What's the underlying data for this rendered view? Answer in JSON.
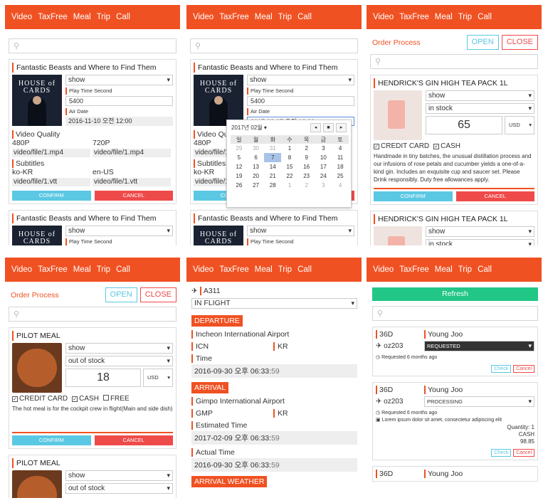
{
  "nav": [
    "Video",
    "TaxFree",
    "Meal",
    "Trip",
    "Call"
  ],
  "video": {
    "title": "Fantastic Beasts and Where to Find Them",
    "poster_text": "HOUSE of CARDS",
    "display": "show",
    "play_time_label": "Play Time Second",
    "play_time": "5400",
    "air_date_label": "Air Date",
    "air_date": "2016-11-10 오전 12:00",
    "air_date2": "2017-02-07 오전 12:00",
    "quality_label": "Video Quality",
    "q1": "480P",
    "q2": "720P",
    "q1_path": "video/file/1.mp4",
    "q2_path": "video/file/1.mp4",
    "subs_label": "Subtitles",
    "s1": "ko-KR",
    "s2": "en-US",
    "s1_path": "video/file/1.vtt",
    "s2_path": "video/file/1.vtt",
    "confirm": "CONFIRM",
    "cancel": "CANCEL"
  },
  "calendar": {
    "month": "2017년 02월",
    "weekdays": [
      "일",
      "월",
      "화",
      "수",
      "목",
      "금",
      "토"
    ],
    "weeks": [
      [
        "29",
        "30",
        "31",
        "1",
        "2",
        "3",
        "4"
      ],
      [
        "5",
        "6",
        "7",
        "8",
        "9",
        "10",
        "11"
      ],
      [
        "12",
        "13",
        "14",
        "15",
        "16",
        "17",
        "18"
      ],
      [
        "19",
        "20",
        "21",
        "22",
        "23",
        "24",
        "25"
      ],
      [
        "26",
        "27",
        "28",
        "1",
        "2",
        "3",
        "4"
      ]
    ]
  },
  "order": {
    "title": "Order Process",
    "open": "OPEN",
    "close": "CLOSE"
  },
  "gin": {
    "name": "HENDRICK'S GIN HIGH TEA PACK 1L",
    "display": "show",
    "stock": "in stock",
    "price": "65",
    "currency": "USD",
    "credit": "CREDIT CARD",
    "cash": "CASH",
    "desc": "Handmade in tiny batches, the unusual distillation process and our infusions of rose petals and cucumber yields a one-of-a-kind gin. Includes an exquisite cup and saucer set. Please Drink responsibly. Duty free allowances apply.",
    "confirm": "CONFIRM",
    "cancel": "CANCEL"
  },
  "meal": {
    "name": "PILOT MEAL",
    "display": "show",
    "stock": "out of stock",
    "price": "18",
    "currency": "USD",
    "credit": "CREDIT CARD",
    "cash": "CASH",
    "free": "FREE",
    "desc": "The hot meal is for the cockpit crew in flight(Main and side dish)",
    "confirm": "CONFIRM",
    "cancel": "CANCEL",
    "stock2": "out of stock"
  },
  "flight": {
    "aircraft": "A311",
    "status": "IN FLIGHT",
    "dep_header": "DEPARTURE",
    "dep_airport": "Incheon International Airport",
    "dep_code": "ICN",
    "dep_country": "KR",
    "time_label": "Time",
    "dep_time": "2016-09-30 오후 06:33:",
    "dep_sec": "59",
    "arr_header": "ARRIVAL",
    "arr_airport": "Gimpo International Airport",
    "arr_code": "GMP",
    "arr_country": "KR",
    "est_label": "Estimated Time",
    "est_time": "2017-02-09 오후 06:33:",
    "est_sec": "59",
    "act_label": "Actual Time",
    "act_time": "2016-09-30 오후 06:33:",
    "act_sec": "59",
    "weather_header": "ARRIVAL WEATHER"
  },
  "orders": {
    "refresh": "Refresh",
    "o1": {
      "seat": "36D",
      "name": "Young Joo",
      "flight": "oz203",
      "status": "REQUESTED",
      "time": "Requested 6 months ago",
      "check": "Check",
      "cancel": "Cancel"
    },
    "o2": {
      "seat": "36D",
      "name": "Young Joo",
      "flight": "oz203",
      "status": "PROCESSING",
      "time": "Requested 6 months ago",
      "item": "Lorem ipsum dolor sit amet, consectetur adipiscing elit",
      "qty": "Quantity: 1",
      "pay": "CASH",
      "amount": "98.85",
      "check": "Check",
      "cancel": "Cancel"
    },
    "o3": {
      "seat": "36D",
      "name": "Young Joo"
    }
  }
}
